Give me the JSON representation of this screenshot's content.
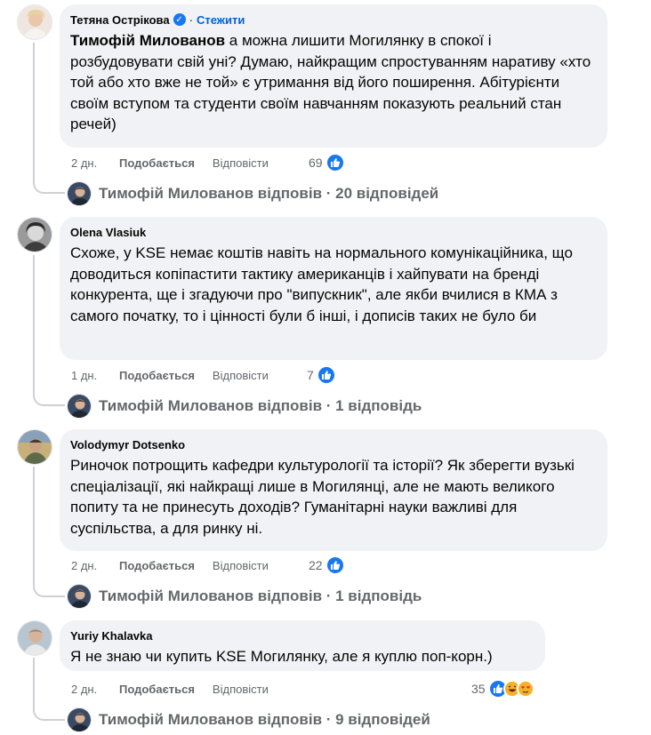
{
  "comments": [
    {
      "author": "Тетяна Острікова",
      "verified": true,
      "follow_label": "Стежити",
      "mention": "Тимофій Милованов",
      "text": " а можна лишити Могилянку в спокої і розбудовувати свій уні? Думаю, найкращим спростуванням наративу «хто той або хто вже не той» є утримання від його поширення. Абітурієнти своїм вступом та студенти своїм навчанням показують реальний стан речей)",
      "time": "2 дн.",
      "like_label": "Подобається",
      "reply_label": "Відповісти",
      "reaction_count": "69",
      "replies_summary": "Тимофій Милованов відповів · 20 відповідей"
    },
    {
      "author": "Olena Vlasiuk",
      "text": "Схоже, у KSE немає коштів навіть на нормального комунікаційника, що доводиться копіпастити тактику американців і хайпувати на бренді конкурента, ще і згадуючи про \"випускник\", але якби вчилися в КМА з самого початку, то і цінності були б інші, і дописів таких не було би",
      "time": "1 дн.",
      "like_label": "Подобається",
      "reply_label": "Відповісти",
      "reaction_count": "7",
      "replies_summary": "Тимофій Милованов відповів · 1 відповідь"
    },
    {
      "author": "Volodymyr Dotsenko",
      "text": "Риночок потрощить кафедри культурології та історії? Як зберегти вузькі спеціалізації, які найкращі лише в Могилянці, але не мають великого попиту та не принесуть доходів? Гуманітарні науки важливі для суспільства, а для ринку ні.",
      "time": "2 дн.",
      "like_label": "Подобається",
      "reply_label": "Відповісти",
      "reaction_count": "22",
      "replies_summary": "Тимофій Милованов відповів · 1 відповідь"
    },
    {
      "author": "Yuriy Khalavka",
      "text": "Я не знаю чи купить KSE Могилянку, але я куплю поп-корн.)",
      "time": "2 дн.",
      "like_label": "Подобається",
      "reply_label": "Відповісти",
      "reaction_count": "35",
      "replies_summary": "Тимофій Милованов відповів · 9 відповідей"
    }
  ],
  "colors": {
    "bubble": "#f0f2f5",
    "meta": "#65676b",
    "link": "#0064d1",
    "like_blue": "#1877f2",
    "thread_line": "#ced0d4"
  },
  "icons": {
    "verified": "verified-badge-icon",
    "like": "thumbs-up-icon",
    "haha": "laughing-face-icon",
    "love": "heart-face-icon"
  }
}
